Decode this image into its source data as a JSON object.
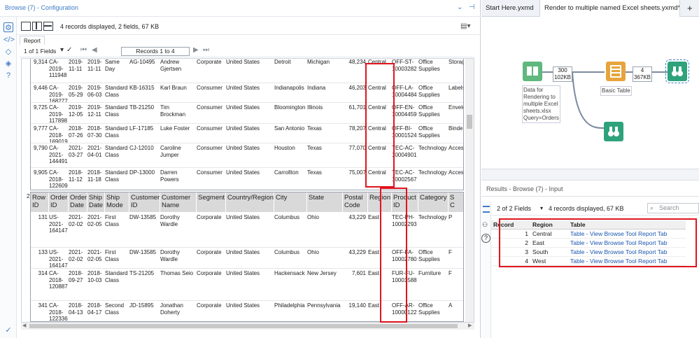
{
  "left_panel": {
    "title": "Browse (7) - Configuration",
    "record_info": "4 records displayed, 2 fields, 67 KB",
    "report_tab": "Report",
    "fields_selector": "1 of 1 Fields",
    "records_range": "Records 1 to 4"
  },
  "group1": {
    "rows": [
      {
        "rowid": "9,314",
        "orderid": "CA-\n2019-\n111948",
        "orderdate": "2019-\n11-11",
        "shipdate": "2019-\n11-11",
        "shipmode": "Same\nDay",
        "custid": "AG-10495",
        "custname": "Andrew\nGjertsen",
        "segment": "Corporate",
        "country": "United States",
        "city": "Detroit",
        "state": "Michigan",
        "postal": "48,234",
        "region": "Central",
        "productid": "OFF-ST-\n10003282",
        "category": "Office\nSupplies",
        "subcat": "Storage"
      },
      {
        "rowid": "9,446",
        "orderid": "CA-\n2019-\n168277",
        "orderdate": "2019-\n05-29",
        "shipdate": "2019-\n06-03",
        "shipmode": "Standard\nClass",
        "custid": "KB-16315",
        "custname": "Karl Braun",
        "segment": "Consumer",
        "country": "United States",
        "city": "Indianapolis",
        "state": "Indiana",
        "postal": "46,203",
        "region": "Central",
        "productid": "OFF-LA-\n10004484",
        "category": "Office\nSupplies",
        "subcat": "Labels"
      },
      {
        "rowid": "9,725",
        "orderid": "CA-\n2019-\n117898",
        "orderdate": "2019-\n12-05",
        "shipdate": "2019-\n12-11",
        "shipmode": "Standard\nClass",
        "custid": "TB-21250",
        "custname": "Tim\nBrockman",
        "segment": "Consumer",
        "country": "United States",
        "city": "Bloomington",
        "state": "Illinois",
        "postal": "61,701",
        "region": "Central",
        "productid": "OFF-EN-\n10004459",
        "category": "Office\nSupplies",
        "subcat": "Envelop"
      },
      {
        "rowid": "9,777",
        "orderid": "CA-\n2018-\n169019",
        "orderdate": "2018-\n07-26",
        "shipdate": "2018-\n07-30",
        "shipmode": "Standard\nClass",
        "custid": "LF-17185",
        "custname": "Luke Foster",
        "segment": "Consumer",
        "country": "United States",
        "city": "San Antonio",
        "state": "Texas",
        "postal": "78,207",
        "region": "Central",
        "productid": "OFF-BI-\n10001524",
        "category": "Office\nSupplies",
        "subcat": "Binders"
      },
      {
        "rowid": "9,790",
        "orderid": "CA-\n2021-\n144491",
        "orderdate": "2021-\n03-27",
        "shipdate": "2021-\n04-01",
        "shipmode": "Standard\nClass",
        "custid": "CJ-12010",
        "custname": "Caroline\nJumper",
        "segment": "Consumer",
        "country": "United States",
        "city": "Houston",
        "state": "Texas",
        "postal": "77,070",
        "region": "Central",
        "productid": "TEC-AC-\n10004901",
        "category": "Technology",
        "subcat": "Access"
      },
      {
        "rowid": "9,905",
        "orderid": "CA-\n2018-\n122609",
        "orderdate": "2018-\n11-12",
        "shipdate": "2018-\n11-18",
        "shipmode": "Standard\nClass",
        "custid": "DP-13000",
        "custname": "Darren\nPowers",
        "segment": "Consumer",
        "country": "United States",
        "city": "Carrollton",
        "state": "Texas",
        "postal": "75,007",
        "region": "Central",
        "productid": "TEC-AC-\n10002567",
        "category": "Technology",
        "subcat": "Access"
      }
    ]
  },
  "group2": {
    "number": "2",
    "headers": [
      "Row\nID",
      "Order\nID",
      "Order\nDate",
      "Ship\nDate",
      "Ship\nMode",
      "Customer\nID",
      "Customer\nName",
      "Segment",
      "Country/Region",
      "City",
      "State",
      "Postal\nCode",
      "Region",
      "Product\nID",
      "Category",
      "S\nC"
    ],
    "rows": [
      {
        "rowid": "131",
        "orderid": "US-\n2021-\n164147",
        "orderdate": "2021-\n02-02",
        "shipdate": "2021-\n02-05",
        "shipmode": "First\nClass",
        "custid": "DW-13585",
        "custname": "Dorothy\nWardle",
        "segment": "Corporate",
        "country": "United States",
        "city": "Columbus",
        "state": "Ohio",
        "postal": "43,229",
        "region": "East",
        "productid": "TEC-PH-\n10002293",
        "category": "Technology",
        "subcat": "P"
      },
      {
        "rowid": "133",
        "orderid": "US-\n2021-\n164147",
        "orderdate": "2021-\n02-02",
        "shipdate": "2021-\n02-05",
        "shipmode": "First\nClass",
        "custid": "DW-13585",
        "custname": "Dorothy\nWardle",
        "segment": "Corporate",
        "country": "United States",
        "city": "Columbus",
        "state": "Ohio",
        "postal": "43,229",
        "region": "East",
        "productid": "OFF-FA-\n10002780",
        "category": "Office\nSupplies",
        "subcat": "F"
      },
      {
        "rowid": "314",
        "orderid": "CA-\n2018-\n120887",
        "orderdate": "2018-\n09-27",
        "shipdate": "2018-\n10-03",
        "shipmode": "Standard\nClass",
        "custid": "TS-21205",
        "custname": "Thomas Seio",
        "segment": "Corporate",
        "country": "United States",
        "city": "Hackensack",
        "state": "New Jersey",
        "postal": "7,601",
        "region": "East",
        "productid": "FUR-FU-\n10001588",
        "category": "Furniture",
        "subcat": "F"
      },
      {
        "rowid": "341",
        "orderid": "CA-\n2018-\n122336",
        "orderdate": "2018-\n04-13",
        "shipdate": "2018-\n04-17",
        "shipmode": "Second\nClass",
        "custid": "JD-15895",
        "custname": "Jonathan\nDoherty",
        "segment": "Corporate",
        "country": "United States",
        "city": "Philadelphia",
        "state": "Pennsylvania",
        "postal": "19,140",
        "region": "East",
        "productid": "OFF-AR-\n10000122",
        "category": "Office\nSupplies",
        "subcat": "A"
      }
    ]
  },
  "right_panel": {
    "tab1": "Start Here.yxmd",
    "tab2": "Render to multiple named Excel sheets.yxmd*",
    "input_count": "300\n102KB",
    "input_label": "Data for\nRendering to\nmultiple Excel\nsheets.xlsx\nQuery=Orders",
    "table_label": "Basic Table",
    "table_count": "4\n367KB",
    "results_title": "Results - Browse (7) - Input",
    "results_fields": "2 of 2 Fields",
    "results_info": "4 records displayed, 67 KB",
    "search_placeholder": "Search",
    "table_headers": [
      "Record",
      "Region",
      "Table"
    ],
    "table_rows": [
      [
        "1",
        "Central",
        "Table - View Browse Tool Report Tab"
      ],
      [
        "2",
        "East",
        "Table - View Browse Tool Report Tab"
      ],
      [
        "3",
        "South",
        "Table - View Browse Tool Report Tab"
      ],
      [
        "4",
        "West",
        "Table - View Browse Tool Report Tab"
      ]
    ]
  },
  "colors": {
    "accent": "#3f7cc6",
    "highlight": "#e0141e",
    "input_tool": "#5fb87e",
    "table_tool": "#e7a43c",
    "browse_tool": "#2ea27a"
  }
}
